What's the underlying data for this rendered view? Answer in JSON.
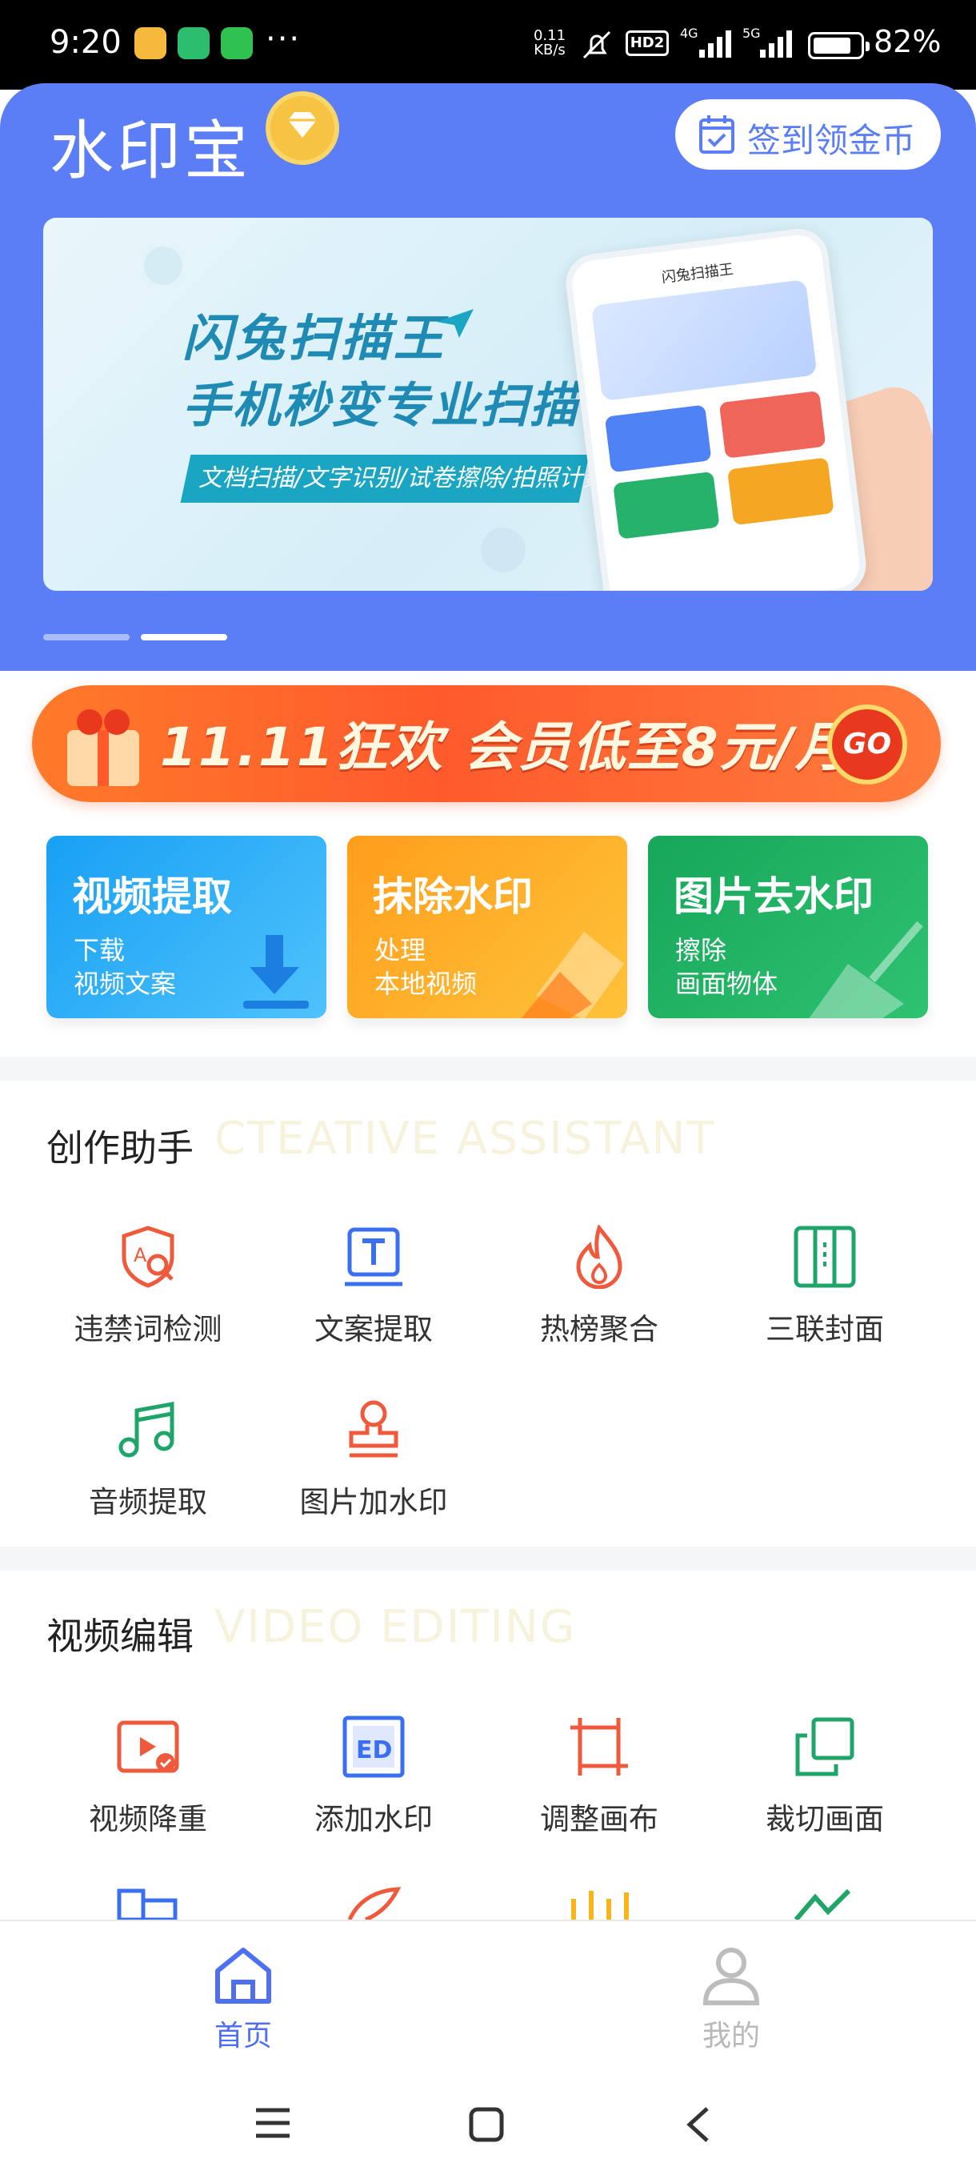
{
  "status_bar": {
    "time": "9:20",
    "more": "···",
    "speed_value": "0.11",
    "speed_unit": "KB/s",
    "hd": "HD2",
    "net1": "4G",
    "net2": "5G",
    "battery_percent": "82%",
    "battery_level": 0.82
  },
  "header": {
    "app_title": "水印宝",
    "signin_label": "签到领金币",
    "bg_color": "#5b7ef7"
  },
  "banner": {
    "line1": "闪兔扫描王",
    "line2": "手机秒变专业扫描仪",
    "strip": "文档扫描/文字识别/试卷擦除/拍照计数",
    "phone_title": "闪兔扫描王",
    "active_index": 1,
    "count": 2
  },
  "promo": {
    "text": "11.11狂欢 会员低至8元/月",
    "go_label": "GO"
  },
  "features": [
    {
      "title": "视频提取",
      "sub1": "下载",
      "sub2": "视频文案",
      "color": "#27a6f5"
    },
    {
      "title": "抹除水印",
      "sub1": "处理",
      "sub2": "本地视频",
      "color": "#ff9b1f"
    },
    {
      "title": "图片去水印",
      "sub1": "擦除",
      "sub2": "画面物体",
      "color": "#1fb063"
    }
  ],
  "creative": {
    "title": "创作助手",
    "subtitle": "CTEATIVE ASSISTANT",
    "tools": [
      {
        "label": "违禁词检测",
        "icon": "shield-search-icon"
      },
      {
        "label": "文案提取",
        "icon": "text-extract-icon"
      },
      {
        "label": "热榜聚合",
        "icon": "flame-icon"
      },
      {
        "label": "三联封面",
        "icon": "triple-cover-icon"
      },
      {
        "label": "音频提取",
        "icon": "music-note-icon"
      },
      {
        "label": "图片加水印",
        "icon": "stamp-icon"
      }
    ]
  },
  "video_edit": {
    "title": "视频编辑",
    "subtitle": "VIDEO EDITING",
    "tools": [
      {
        "label": "视频降重",
        "icon": "video-dedupe-icon"
      },
      {
        "label": "添加水印",
        "icon": "add-watermark-icon"
      },
      {
        "label": "调整画布",
        "icon": "canvas-adjust-icon"
      },
      {
        "label": "裁切画面",
        "icon": "crop-icon"
      }
    ]
  },
  "bottom_nav": {
    "items": [
      {
        "label": "首页",
        "icon": "home-icon",
        "active": true
      },
      {
        "label": "我的",
        "icon": "profile-icon",
        "active": false
      }
    ]
  }
}
